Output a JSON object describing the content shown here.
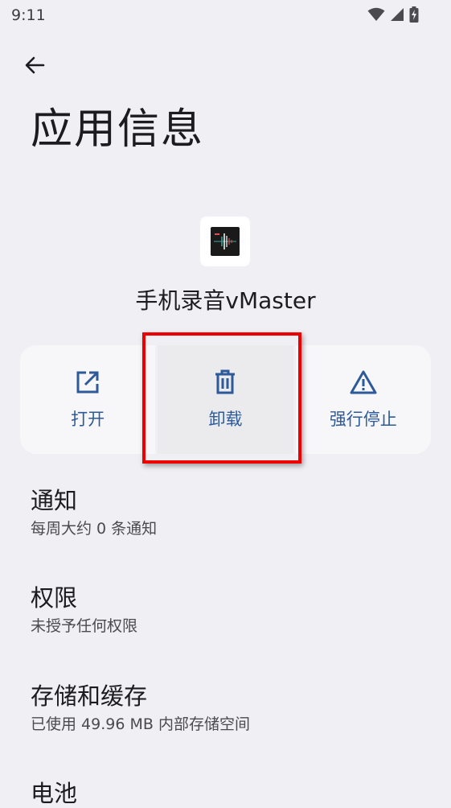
{
  "status_bar": {
    "time": "9:11",
    "icons": [
      "wifi-icon",
      "signal-icon",
      "battery-charging-icon"
    ]
  },
  "header": {
    "title": "应用信息"
  },
  "app": {
    "name": "手机录音vMaster"
  },
  "actions": [
    {
      "label": "打开",
      "icon": "open-external-icon"
    },
    {
      "label": "卸载",
      "icon": "trash-icon"
    },
    {
      "label": "强行停止",
      "icon": "warning-icon"
    }
  ],
  "settings": [
    {
      "title": "通知",
      "subtitle": "每周大约 0 条通知"
    },
    {
      "title": "权限",
      "subtitle": "未授予任何权限"
    },
    {
      "title": "存储和缓存",
      "subtitle": "已使用 49.96 MB 内部存储空间"
    },
    {
      "title": "电池",
      "subtitle": ""
    }
  ],
  "colors": {
    "background": "#f0eff4",
    "accent": "#2e5a9a",
    "highlight": "#ee0000"
  }
}
